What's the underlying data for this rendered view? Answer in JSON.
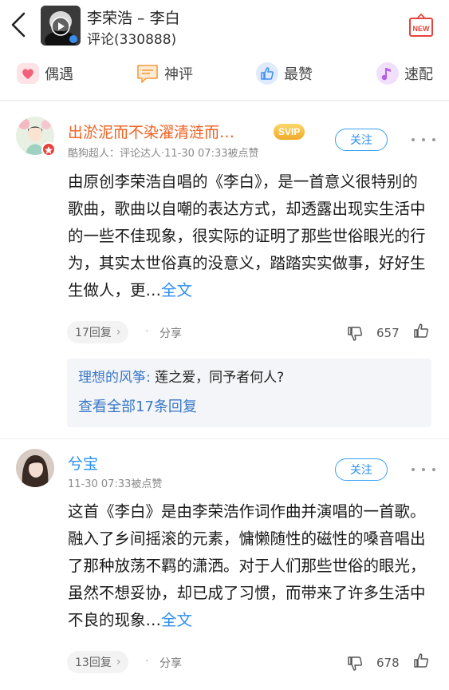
{
  "header": {
    "song_title": "李荣浩 – 李白",
    "comment_count": "评论(330888)",
    "badge": "NEW"
  },
  "tabs": [
    {
      "label": "偶遇",
      "icon": "heart-icon",
      "color": "#f2607a"
    },
    {
      "label": "神评",
      "icon": "chat-icon",
      "color": "#f39c3c"
    },
    {
      "label": "最赞",
      "icon": "thumbs-up-icon",
      "color": "#3d8ef7"
    },
    {
      "label": "速配",
      "icon": "music-note-icon",
      "color": "#b45fe8"
    }
  ],
  "comments": [
    {
      "username": "出淤泥而不染濯清涟而…",
      "vip_badge": "SVIP",
      "meta": "酷狗超人：评论达人·11-30 07:33被点赞",
      "follow_label": "关注",
      "text": "由原创李荣浩自唱的《李白》，是一首意义很特别的歌曲，歌曲以自嘲的表达方式，却透露出现实生活中的一些不佳现象，很实际的证明了那些世俗眼光的行为，其实太世俗真的没意义，踏踏实实做事，好好生生做人，更…",
      "full_label": "全文",
      "replies_label": "17回复",
      "share_label": "分享",
      "likes": "657",
      "reply_preview": {
        "user": "理想的风筝:",
        "content": "莲之爱，同予者何人?"
      },
      "view_all_label": "查看全部17条回复"
    },
    {
      "username": "兮宝",
      "meta": "11-30 07:33被点赞",
      "follow_label": "关注",
      "text": "这首《李白》是由李荣浩作词作曲并演唱的一首歌。融入了乡间摇滚的元素，慵懒随性的磁性的嗓音唱出了那种放荡不羁的潇洒。对于人们那些世俗的眼光，虽然不想妥协，却已成了习惯，而带来了许多生活中不良的现象…",
      "full_label": "全文",
      "replies_label": "13回复",
      "share_label": "分享",
      "likes": "678"
    }
  ],
  "colors": {
    "accent_blue": "#2a8ef0",
    "username_orange": "#f0601e",
    "svip_gold": "#f5b93a"
  }
}
